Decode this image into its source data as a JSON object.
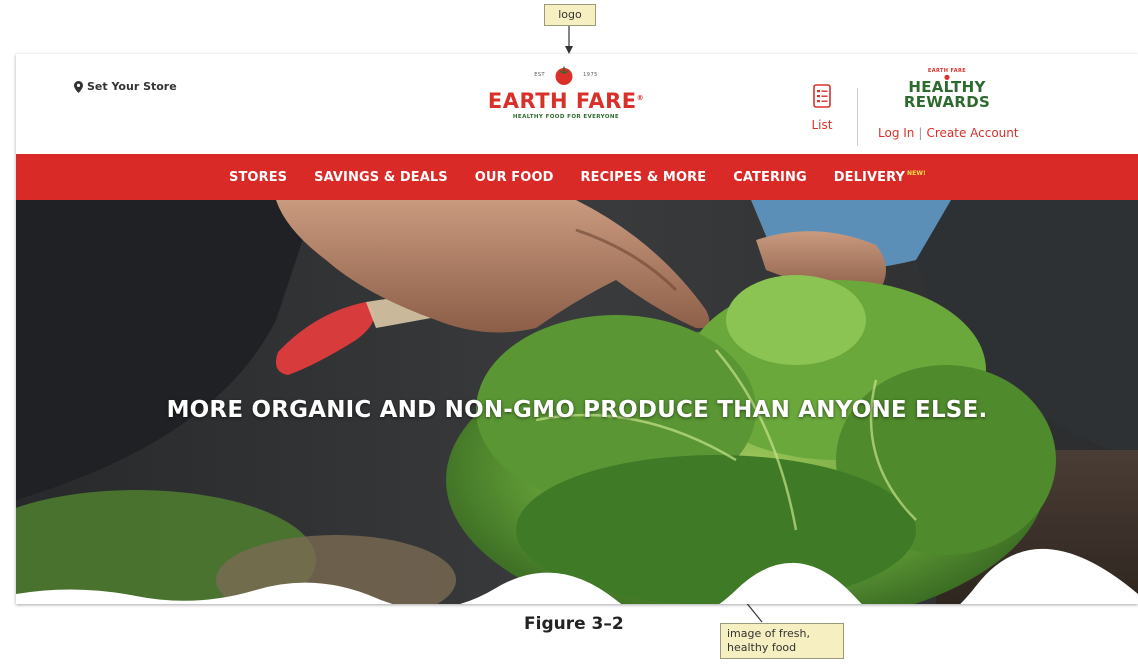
{
  "annotations": {
    "logo_callout": "logo",
    "image_callout_line1": "image of fresh,",
    "image_callout_line2": "healthy food",
    "figure_caption": "Figure 3–2"
  },
  "header": {
    "store_link": "Set Your Store",
    "logo": {
      "est_left": "EST",
      "est_right": "1975",
      "name": "EARTH FARE",
      "tagline": "HEALTHY FOOD FOR EVERYONE"
    },
    "list_label": "List",
    "rewards": {
      "small_text": "EARTH FARE",
      "line1": "HEALTHY",
      "line2": "REWARDS"
    },
    "login_label": "Log In",
    "separator": "|",
    "create_account_label": "Create Account"
  },
  "nav": {
    "items": [
      {
        "label": "STORES"
      },
      {
        "label": "SAVINGS & DEALS"
      },
      {
        "label": "OUR FOOD"
      },
      {
        "label": "RECIPES & MORE"
      },
      {
        "label": "CATERING"
      },
      {
        "label": "DELIVERY",
        "badge": "NEW!"
      }
    ]
  },
  "hero": {
    "headline": "MORE ORGANIC AND NON-GMO PRODUCE THAN ANYONE ELSE."
  },
  "colors": {
    "brand_red": "#da2a28",
    "brand_green": "#2d6a2e",
    "callout_fill": "#f6efc2"
  },
  "icons": {
    "store": "map-pin-icon",
    "logo_mark": "tomato-icon",
    "list": "list-document-icon"
  }
}
